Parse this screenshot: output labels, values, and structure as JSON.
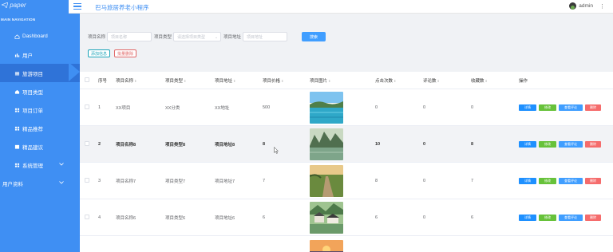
{
  "sidebar": {
    "logo_text": "paper",
    "nav_title": "MAIN NAVIGATION",
    "items": [
      {
        "label": "Dashboard",
        "icon": "home-icon"
      },
      {
        "label": "用户",
        "icon": "chart-icon"
      },
      {
        "label": "旅游项目",
        "icon": "list-icon",
        "active": true
      },
      {
        "label": "项目类型",
        "icon": "home-icon"
      },
      {
        "label": "项目订单",
        "icon": "grid-icon"
      },
      {
        "label": "精品推荐",
        "icon": "grid-icon"
      },
      {
        "label": "精品建议",
        "icon": "list-icon"
      },
      {
        "label": "系统管理",
        "icon": "grid-icon",
        "has_children": true
      },
      {
        "label": "用户资料",
        "icon": "",
        "has_children": true
      }
    ]
  },
  "header": {
    "title": "巴马旅居养老小程序",
    "username": "admin"
  },
  "search": {
    "name_label": "项目名称",
    "name_placeholder": "项目名称",
    "type_label": "项目类型",
    "type_placeholder": "请选择项目类型",
    "addr_label": "项目地址",
    "addr_placeholder": "项目地址",
    "search_button": "搜索"
  },
  "actions": {
    "add": "添加信息",
    "batch_delete": "批量删除"
  },
  "table": {
    "columns": [
      "序号",
      "项目名称",
      "项目类型",
      "项目地址",
      "项目价格",
      "项目图片",
      "点击次数",
      "评论数",
      "收藏数",
      "操作"
    ],
    "rows": [
      {
        "idx": "1",
        "name": "XX项目",
        "type": "XX分类",
        "addr": "XX地址",
        "price": "500",
        "img": "lake",
        "clicks": "0",
        "comments": "0",
        "favs": "0"
      },
      {
        "idx": "2",
        "name": "项目名称8",
        "type": "项目类型8",
        "addr": "项目地址8",
        "price": "8",
        "img": "karst",
        "clicks": "10",
        "comments": "0",
        "favs": "8"
      },
      {
        "idx": "3",
        "name": "项目名称7",
        "type": "项目类型7",
        "addr": "项目地址7",
        "price": "7",
        "img": "path",
        "clicks": "8",
        "comments": "0",
        "favs": "7"
      },
      {
        "idx": "4",
        "name": "项目名称6",
        "type": "项目类型6",
        "addr": "项目地址6",
        "price": "6",
        "img": "village",
        "clicks": "6",
        "comments": "0",
        "favs": "6"
      }
    ],
    "ops": {
      "detail": "详情",
      "edit": "修改",
      "review": "查看评论",
      "delete": "删除"
    }
  },
  "colors": {
    "sidebar": "#3f8ff3",
    "primary": "#409eff",
    "success": "#67c23a",
    "danger": "#f56c6c"
  }
}
